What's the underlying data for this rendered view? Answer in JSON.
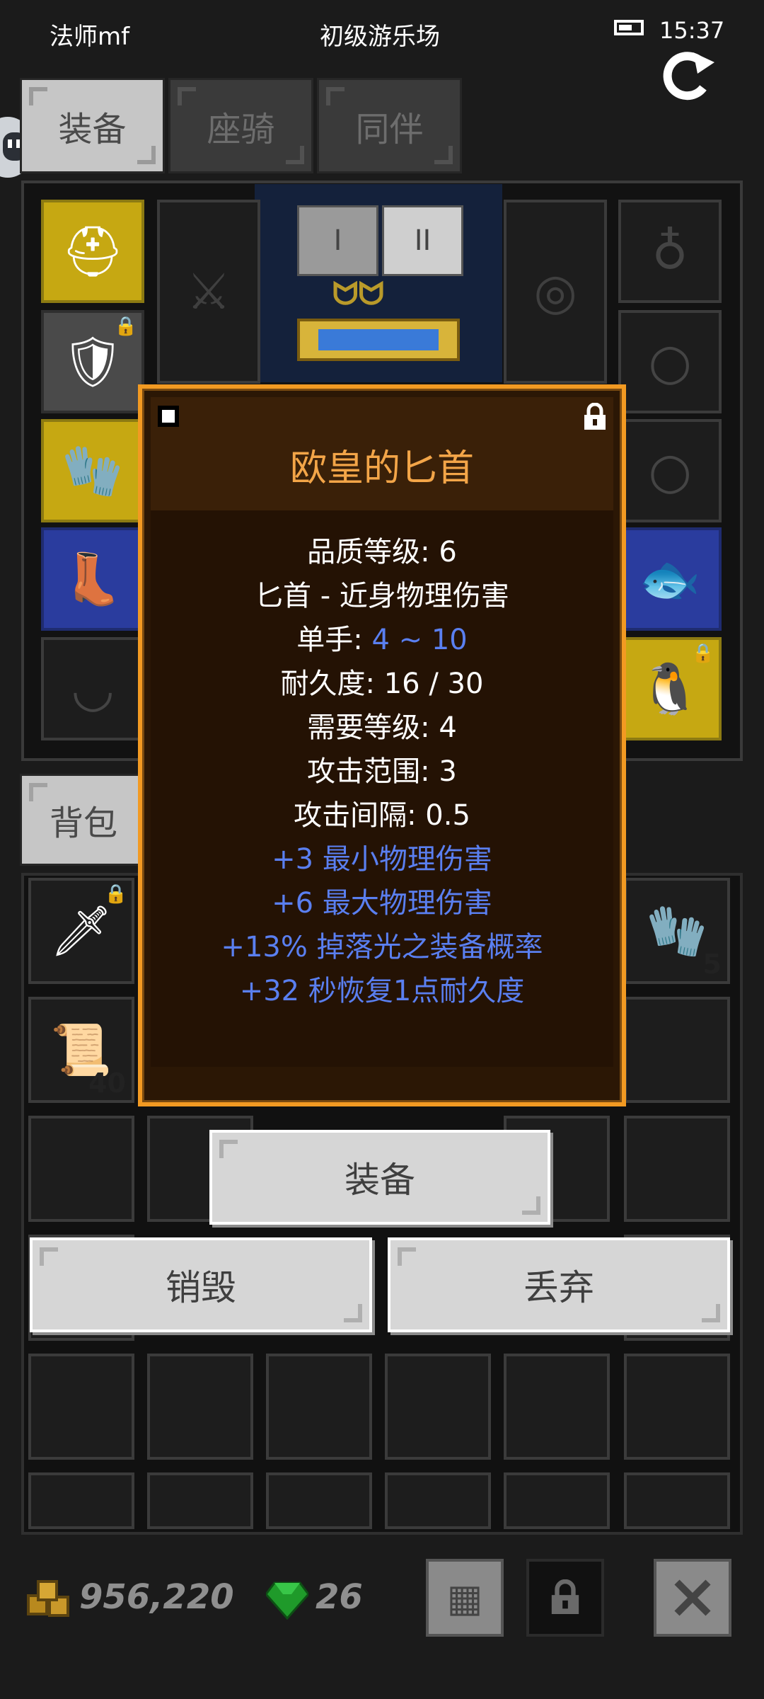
{
  "status_bar": {
    "player_name": "法师mf",
    "location": "初级游乐场",
    "time": "15:37"
  },
  "tabs": [
    {
      "label": "装备",
      "active": true
    },
    {
      "label": "座骑",
      "active": false
    },
    {
      "label": "同伴",
      "active": false
    }
  ],
  "page_buttons": [
    "I",
    "II"
  ],
  "stacks": {
    "gloves_count": "5",
    "scroll_count": "40"
  },
  "backpack_tab": "背包",
  "item_popup": {
    "title": "欧皇的匕首",
    "quality": "品质等级: 6",
    "type": "匕首 - 近身物理伤害",
    "damage_label": "单手: ",
    "damage_value": "4 ~ 10",
    "durability": "耐久度: 16 / 30",
    "required_level": "需要等级: 4",
    "attack_range": "攻击范围: 3",
    "attack_interval": "攻击间隔: 0.5",
    "bonuses": [
      "+3 最小物理伤害",
      "+6 最大物理伤害",
      "+13% 掉落光之装备概率",
      "+32 秒恢复1点耐久度"
    ]
  },
  "actions": {
    "equip": "装备",
    "destroy": "销毁",
    "discard": "丢弃"
  },
  "currency": {
    "gold": "956,220",
    "gems": "26"
  },
  "colors": {
    "popup_border": "#f29a22",
    "title": "#f3a548",
    "bonus": "#5a7ff0"
  }
}
